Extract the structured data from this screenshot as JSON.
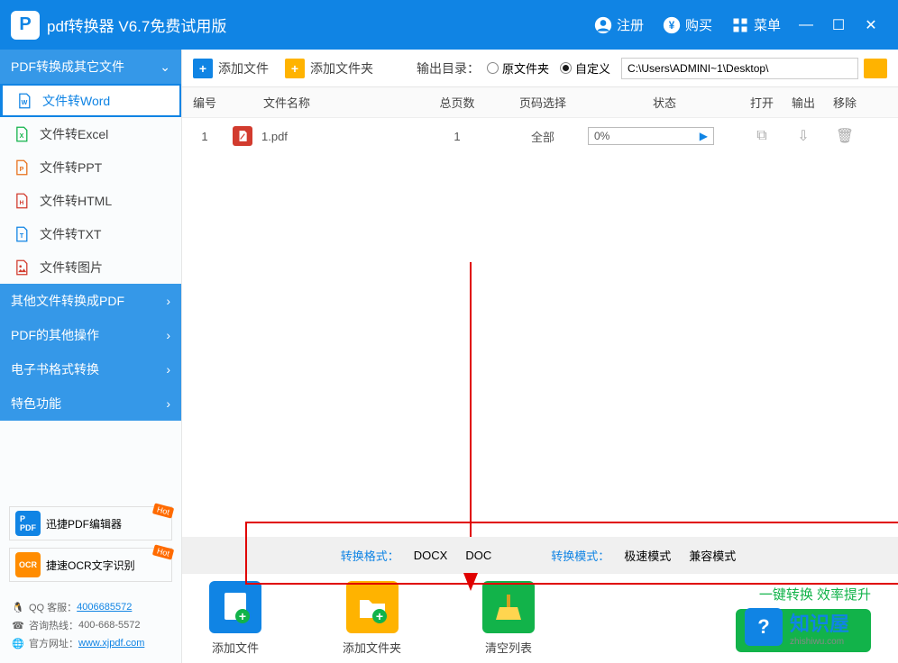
{
  "titlebar": {
    "title": "pdf转换器 V6.7免费试用版",
    "register": "注册",
    "buy": "购买",
    "menu": "菜单"
  },
  "sidebar": {
    "cat0": "PDF转换成其它文件",
    "items": [
      {
        "label": "文件转Word",
        "active": true
      },
      {
        "label": "文件转Excel"
      },
      {
        "label": "文件转PPT"
      },
      {
        "label": "文件转HTML"
      },
      {
        "label": "文件转TXT"
      },
      {
        "label": "文件转图片"
      }
    ],
    "cat1": "其他文件转换成PDF",
    "cat2": "PDF的其他操作",
    "cat3": "电子书格式转换",
    "cat4": "特色功能",
    "promo1": "迅捷PDF编辑器",
    "promo2": "捷速OCR文字识别",
    "hot": "Hot",
    "qq_label": "QQ 客服：",
    "qq_value": "4006685572",
    "tel_label": "咨询热线：",
    "tel_value": "400-668-5572",
    "web_label": "官方网址：",
    "web_value": "www.xjpdf.com"
  },
  "toolbar": {
    "add_file": "添加文件",
    "add_folder": "添加文件夹",
    "output_label": "输出目录：",
    "radio_source": "原文件夹",
    "radio_custom": "自定义",
    "path": "C:\\Users\\ADMINI~1\\Desktop\\"
  },
  "table": {
    "headers": {
      "num": "编号",
      "name": "文件名称",
      "pages": "总页数",
      "sel": "页码选择",
      "status": "状态",
      "open": "打开",
      "out": "输出",
      "del": "移除"
    },
    "rows": [
      {
        "num": "1",
        "name": "1.pdf",
        "pages": "1",
        "sel": "全部",
        "status": "0%"
      }
    ]
  },
  "format_bar": {
    "fmt_label": "转换格式：",
    "fmt_docx": "DOCX",
    "fmt_doc": "DOC",
    "mode_label": "转换模式：",
    "mode_fast": "极速模式",
    "mode_compat": "兼容模式"
  },
  "bottom": {
    "add_file": "添加文件",
    "add_folder": "添加文件夹",
    "clear": "清空列表",
    "hint": "一键转换  效率提升"
  },
  "watermark": {
    "big": "知识屋",
    "small": "zhishiwu.com"
  }
}
